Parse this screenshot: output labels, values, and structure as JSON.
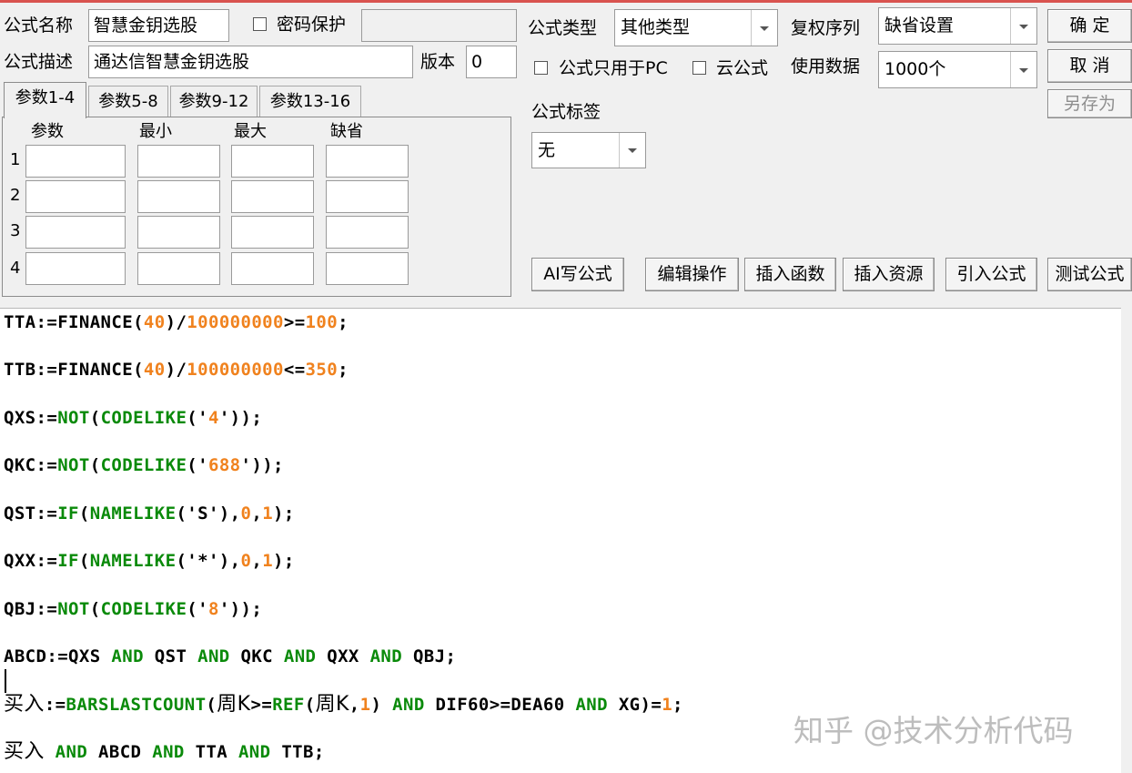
{
  "window": {
    "accent_color": "#d9534f"
  },
  "header": {
    "name_label": "公式名称",
    "name_value": "智慧金钥选股",
    "password_label": "密码保护",
    "password_value": "",
    "desc_label": "公式描述",
    "desc_value": "通达信智慧金钥选股",
    "version_label": "版本",
    "version_value": "0",
    "type_label": "公式类型",
    "type_value": "其他类型",
    "restore_label": "复权序列",
    "restore_value": "缺省设置",
    "pc_only_label": "公式只用于PC",
    "cloud_label": "云公式",
    "data_label": "使用数据",
    "data_value": "1000个",
    "tag_label": "公式标签",
    "tag_value": "无"
  },
  "buttons": {
    "ok": "确  定",
    "cancel": "取  消",
    "save_as": "另存为",
    "ai": "AI写公式",
    "edit": "编辑操作",
    "insert_func": "插入函数",
    "insert_res": "插入资源",
    "import": "引入公式",
    "test": "测试公式"
  },
  "params": {
    "tabs": [
      "参数1-4",
      "参数5-8",
      "参数9-12",
      "参数13-16"
    ],
    "columns": [
      "参数",
      "最小",
      "最大",
      "缺省"
    ],
    "rows": [
      "1",
      "2",
      "3",
      "4"
    ]
  },
  "code": {
    "colors": {
      "default": "#000000",
      "number": "#f0821e",
      "function": "#0a8a0a",
      "keyword": "#0a8a0a"
    },
    "lines": [
      [
        [
          "TTA:=FINANCE(",
          "d"
        ],
        [
          "40",
          "n"
        ],
        [
          ")/",
          "d"
        ],
        [
          "100000000",
          "n"
        ],
        [
          ">=",
          "d"
        ],
        [
          "100",
          "n"
        ],
        [
          ";",
          "d"
        ]
      ],
      [
        [
          "TTB:=FINANCE(",
          "d"
        ],
        [
          "40",
          "n"
        ],
        [
          ")/",
          "d"
        ],
        [
          "100000000",
          "n"
        ],
        [
          "<=",
          "d"
        ],
        [
          "350",
          "n"
        ],
        [
          ";",
          "d"
        ]
      ],
      [
        [
          "QXS:=",
          "d"
        ],
        [
          "NOT",
          "f"
        ],
        [
          "(",
          "d"
        ],
        [
          "CODELIKE",
          "f"
        ],
        [
          "('",
          "d"
        ],
        [
          "4",
          "n"
        ],
        [
          "'));",
          "d"
        ]
      ],
      [
        [
          "QKC:=",
          "d"
        ],
        [
          "NOT",
          "f"
        ],
        [
          "(",
          "d"
        ],
        [
          "CODELIKE",
          "f"
        ],
        [
          "('",
          "d"
        ],
        [
          "688",
          "n"
        ],
        [
          "'));",
          "d"
        ]
      ],
      [
        [
          "QST:=",
          "d"
        ],
        [
          "IF",
          "f"
        ],
        [
          "(",
          "d"
        ],
        [
          "NAMELIKE",
          "f"
        ],
        [
          "('S'),",
          "d"
        ],
        [
          "0",
          "n"
        ],
        [
          ",",
          "d"
        ],
        [
          "1",
          "n"
        ],
        [
          ");",
          "d"
        ]
      ],
      [
        [
          "QXX:=",
          "d"
        ],
        [
          "IF",
          "f"
        ],
        [
          "(",
          "d"
        ],
        [
          "NAMELIKE",
          "f"
        ],
        [
          "('*'),",
          "d"
        ],
        [
          "0",
          "n"
        ],
        [
          ",",
          "d"
        ],
        [
          "1",
          "n"
        ],
        [
          ");",
          "d"
        ]
      ],
      [
        [
          "QBJ:=",
          "d"
        ],
        [
          "NOT",
          "f"
        ],
        [
          "(",
          "d"
        ],
        [
          "CODELIKE",
          "f"
        ],
        [
          "('",
          "d"
        ],
        [
          "8",
          "n"
        ],
        [
          "'));",
          "d"
        ]
      ],
      [
        [
          "ABCD:=QXS ",
          "d"
        ],
        [
          "AND",
          "f"
        ],
        [
          " QST ",
          "d"
        ],
        [
          "AND",
          "f"
        ],
        [
          " QKC ",
          "d"
        ],
        [
          "AND",
          "f"
        ],
        [
          " QXX ",
          "d"
        ],
        [
          "AND",
          "f"
        ],
        [
          " QBJ;",
          "d"
        ]
      ],
      [
        [
          "买入",
          "c"
        ],
        [
          ":=",
          "d"
        ],
        [
          "BARSLASTCOUNT",
          "f"
        ],
        [
          "(",
          "d"
        ],
        [
          "周K",
          "c"
        ],
        [
          ">=",
          "d"
        ],
        [
          "REF",
          "f"
        ],
        [
          "(",
          "d"
        ],
        [
          "周K",
          "c"
        ],
        [
          ",",
          "d"
        ],
        [
          "1",
          "n"
        ],
        [
          ") ",
          "d"
        ],
        [
          "AND",
          "f"
        ],
        [
          " DIF60>=DEA60 ",
          "d"
        ],
        [
          "AND",
          "f"
        ],
        [
          " XG)=",
          "d"
        ],
        [
          "1",
          "n"
        ],
        [
          ";",
          "d"
        ]
      ],
      [
        [
          "买入",
          "c"
        ],
        [
          " ",
          "d"
        ],
        [
          "AND",
          "f"
        ],
        [
          " ABCD ",
          "d"
        ],
        [
          "AND",
          "f"
        ],
        [
          " TTA ",
          "d"
        ],
        [
          "AND",
          "f"
        ],
        [
          " TTB;",
          "d"
        ]
      ]
    ]
  },
  "watermark": "知乎 @技术分析代码"
}
